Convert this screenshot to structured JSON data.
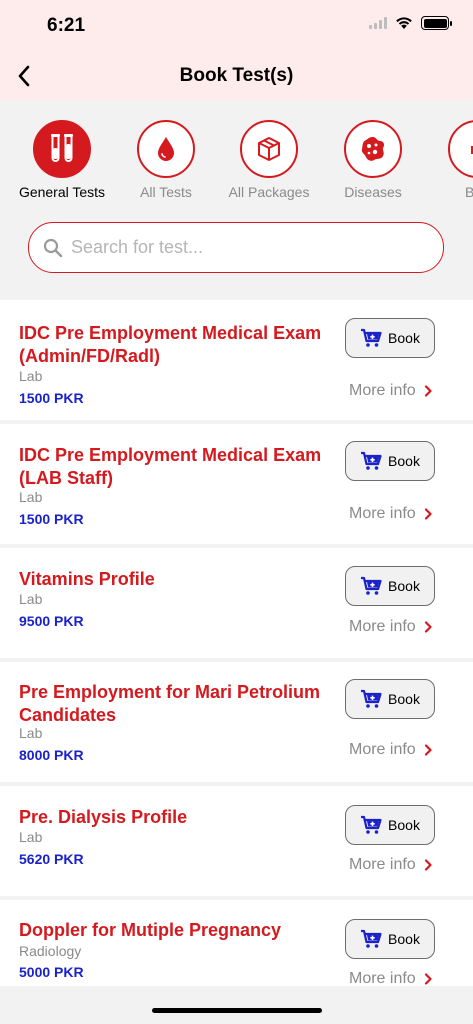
{
  "status": {
    "time": "6:21"
  },
  "nav": {
    "title": "Book Test(s)"
  },
  "categories": [
    {
      "label": "General Tests",
      "icon": "test-tubes-icon",
      "active": true
    },
    {
      "label": "All Tests",
      "icon": "blood-drop-icon",
      "active": false
    },
    {
      "label": "All Packages",
      "icon": "package-box-icon",
      "active": false
    },
    {
      "label": "Diseases",
      "icon": "virus-icon",
      "active": false
    },
    {
      "label": "Boc",
      "icon": "body-icon",
      "active": false
    }
  ],
  "search": {
    "placeholder": "Search for test..."
  },
  "tests": [
    {
      "title": "IDC Pre Employment Medical Exam (Admin/FD/Radl)",
      "type": "Lab",
      "price": "1500 PKR",
      "book_label": "Book",
      "more_label": "More info"
    },
    {
      "title": "IDC Pre Employment Medical Exam (LAB Staff)",
      "type": "Lab",
      "price": "1500 PKR",
      "book_label": "Book",
      "more_label": "More info"
    },
    {
      "title": "Vitamins Profile",
      "type": "Lab",
      "price": "9500 PKR",
      "book_label": "Book",
      "more_label": "More info"
    },
    {
      "title": "Pre Employment for Mari Petrolium Candidates",
      "type": "Lab",
      "price": "8000 PKR",
      "book_label": "Book",
      "more_label": "More info"
    },
    {
      "title": "Pre. Dialysis Profile",
      "type": "Lab",
      "price": "5620 PKR",
      "book_label": "Book",
      "more_label": "More info"
    },
    {
      "title": "Doppler for Mutiple Pregnancy",
      "type": "Radiology",
      "price": "5000 PKR",
      "book_label": "Book",
      "more_label": "More info"
    }
  ],
  "colors": {
    "accent": "#d41a1f",
    "price": "#1a22c9",
    "header_bg": "#fdeceb"
  }
}
